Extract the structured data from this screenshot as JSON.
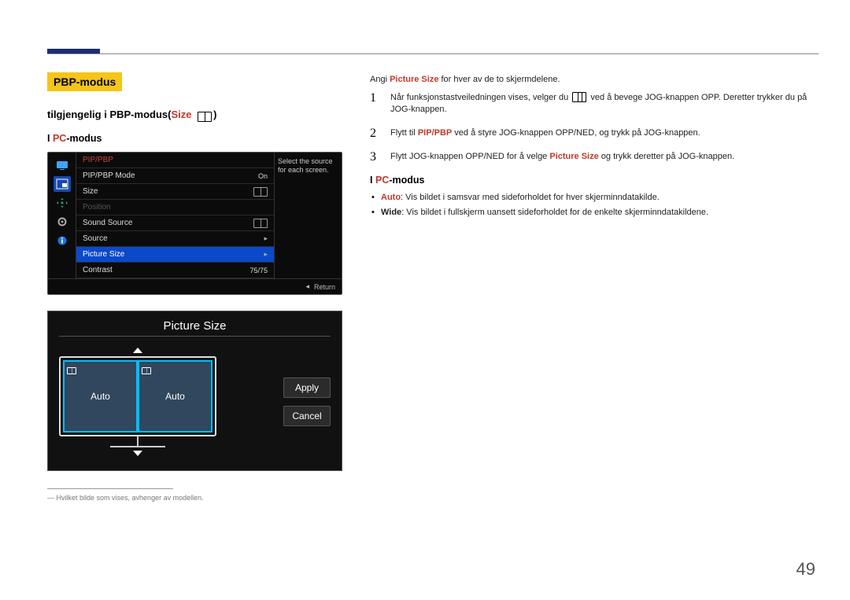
{
  "page_number": "49",
  "section": {
    "badge": "PBP-modus",
    "subtitle_prefix": "tilgjengelig i PBP-modus(",
    "subtitle_red": "Size",
    "subtitle_suffix": ")",
    "pc_mode_label_prefix": "I ",
    "pc_mode_label_red": "PC",
    "pc_mode_label_suffix": "-modus"
  },
  "osd": {
    "title": "PIP/PBP",
    "hint": "Select the source for each screen.",
    "rows": {
      "mode": "PIP/PBP Mode",
      "mode_val": "On",
      "size": "Size",
      "position": "Position",
      "sound": "Sound Source",
      "source": "Source",
      "psize": "Picture Size",
      "contrast": "Contrast",
      "contrast_val": "75/75"
    },
    "return": "Return"
  },
  "panel": {
    "title": "Picture Size",
    "left_label": "Auto",
    "right_label": "Auto",
    "apply": "Apply",
    "cancel": "Cancel"
  },
  "footnote": "Hvilket bilde som vises, avhenger av modellen.",
  "right": {
    "intro_a": "Angi ",
    "intro_b": "Picture Size",
    "intro_c": " for hver av de to skjermdelene.",
    "step1_a": "Når funksjonstastveiledningen vises, velger du ",
    "step1_b": " ved å bevege JOG-knappen OPP. Deretter trykker du på JOG-knappen.",
    "step2_a": "Flytt til ",
    "step2_b": "PIP/PBP",
    "step2_c": " ved å styre JOG-knappen OPP/NED, og trykk på JOG-knappen.",
    "step3_a": "Flytt JOG-knappen OPP/NED for å velge ",
    "step3_b": "Picture Size",
    "step3_c": " og trykk deretter på JOG-knappen.",
    "pc_mode_prefix": "I ",
    "pc_mode_red": "PC",
    "pc_mode_suffix": "-modus",
    "bullet1_label": "Auto",
    "bullet1_text": ": Vis bildet i samsvar med sideforholdet for hver skjerminndatakilde.",
    "bullet2_label": "Wide",
    "bullet2_text": ": Vis bildet i fullskjerm uansett sideforholdet for de enkelte skjerminndatakildene."
  }
}
